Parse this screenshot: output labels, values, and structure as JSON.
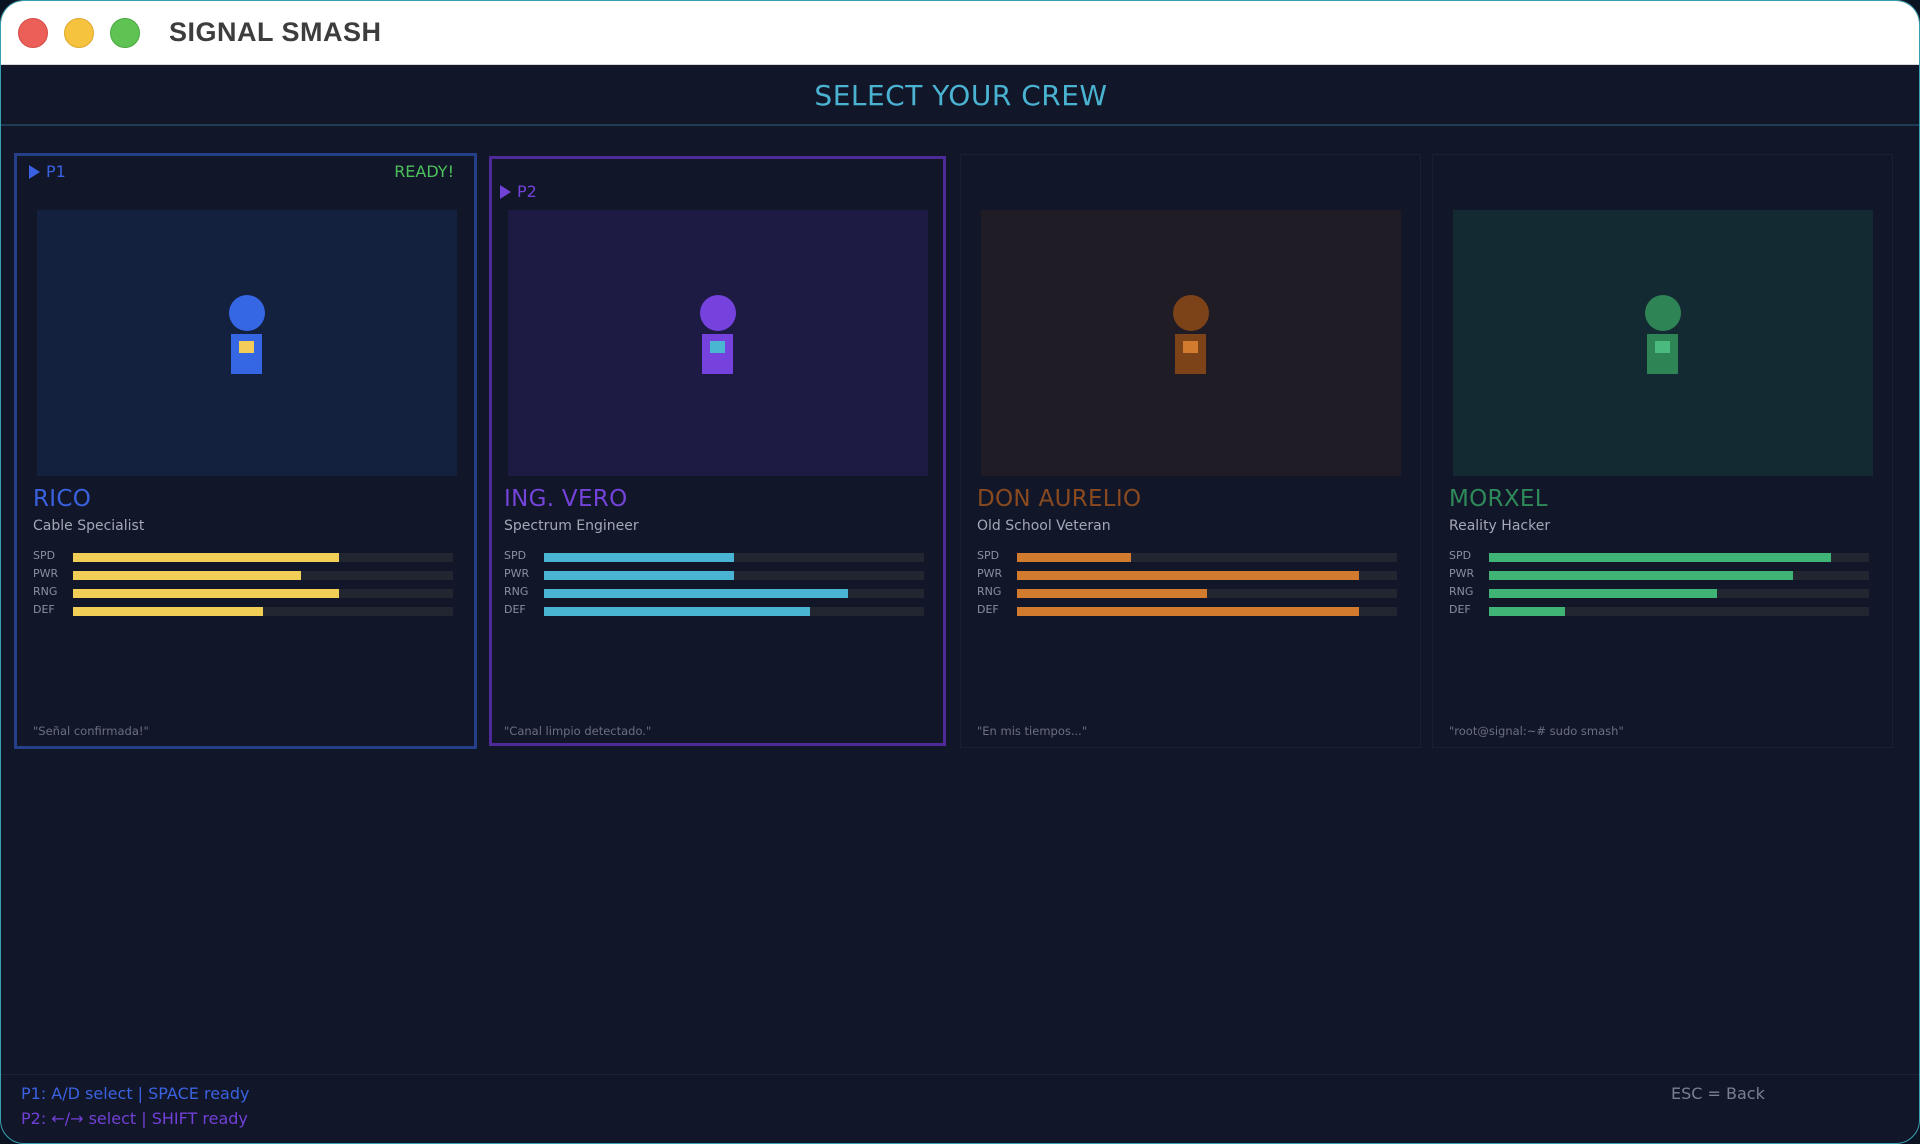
{
  "window": {
    "title": "SIGNAL SMASH"
  },
  "header": {
    "title": "SELECT YOUR CREW"
  },
  "characters": [
    {
      "name": "RICO",
      "role": "Cable Specialist",
      "quote": "\"Señal confirmada!\"",
      "name_color": "#3a62df",
      "bg_color": "#13213f",
      "figure_color": "#3566e4",
      "chip_color": "#f3cc5a",
      "bar_color": "#f1cf57",
      "stats": [
        {
          "label": "SPD",
          "value": 0.7
        },
        {
          "label": "PWR",
          "value": 0.6
        },
        {
          "label": "RNG",
          "value": 0.7
        },
        {
          "label": "DEF",
          "value": 0.5
        }
      ]
    },
    {
      "name": "ING. VERO",
      "role": "Spectrum Engineer",
      "quote": "\"Canal limpio detectado.\"",
      "name_color": "#7443d9",
      "bg_color": "#1d1b44",
      "figure_color": "#7542de",
      "chip_color": "#4ab6d2",
      "bar_color": "#4ab5d3",
      "stats": [
        {
          "label": "SPD",
          "value": 0.5
        },
        {
          "label": "PWR",
          "value": 0.5
        },
        {
          "label": "RNG",
          "value": 0.8
        },
        {
          "label": "DEF",
          "value": 0.7
        }
      ]
    },
    {
      "name": "DON AURELIO",
      "role": "Old School Veteran",
      "quote": "\"En mis tiempos...\"",
      "name_color": "#8a4a1f",
      "bg_color": "#201c26",
      "figure_color": "#7d4318",
      "chip_color": "#d27a2d",
      "bar_color": "#d27a2d",
      "stats": [
        {
          "label": "SPD",
          "value": 0.3
        },
        {
          "label": "PWR",
          "value": 0.9
        },
        {
          "label": "RNG",
          "value": 0.5
        },
        {
          "label": "DEF",
          "value": 0.9
        }
      ]
    },
    {
      "name": "MORXEL",
      "role": "Reality Hacker",
      "quote": "\"root@signal:~# sudo smash\"",
      "name_color": "#2f8a5a",
      "bg_color": "#142a33",
      "figure_color": "#2f8456",
      "chip_color": "#4aba7e",
      "bar_color": "#3fb474",
      "stats": [
        {
          "label": "SPD",
          "value": 0.9
        },
        {
          "label": "PWR",
          "value": 0.8
        },
        {
          "label": "RNG",
          "value": 0.6
        },
        {
          "label": "DEF",
          "value": 0.2
        }
      ]
    }
  ],
  "cursors": {
    "p1": "P1",
    "p2": "P2",
    "ready": "READY!"
  },
  "footer": {
    "p1_hint": "P1: A/D select | SPACE ready",
    "p2_hint": "P2: ←/→ select | SHIFT ready",
    "esc_hint": "ESC = Back"
  }
}
